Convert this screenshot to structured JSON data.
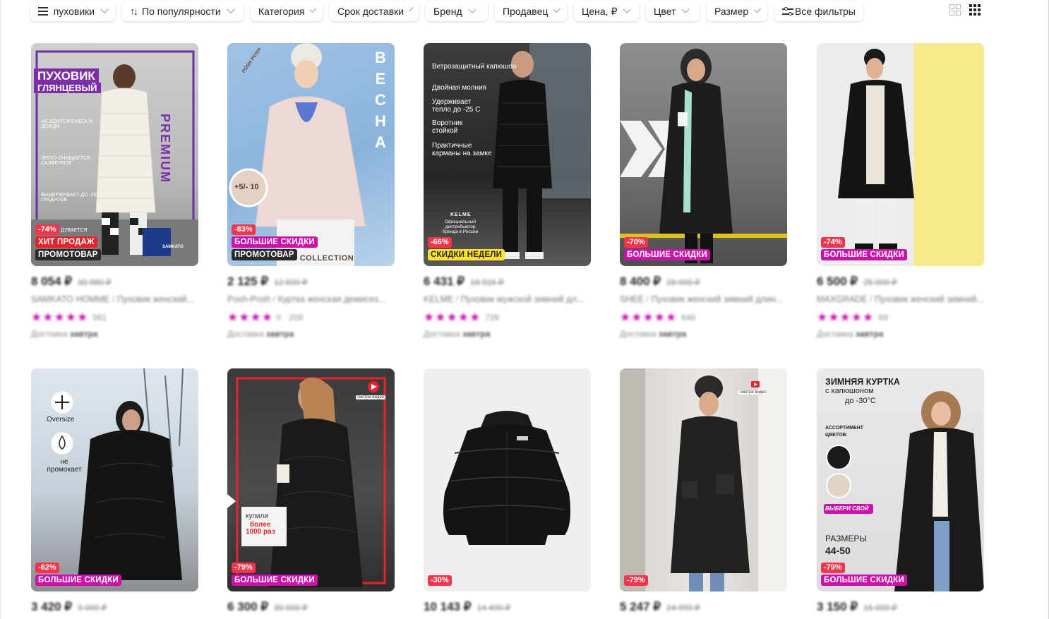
{
  "filters": [
    {
      "label": "пуховики",
      "icon": "menu-icon"
    },
    {
      "label": "По популярности",
      "icon": "sort-icon"
    },
    {
      "label": "Категория"
    },
    {
      "label": "Срок доставки"
    },
    {
      "label": "Бренд"
    },
    {
      "label": "Продавец"
    },
    {
      "label": "Цена, ₽"
    },
    {
      "label": "Цвет"
    },
    {
      "label": "Размер"
    },
    {
      "label": "Все фильтры",
      "icon": "sliders-icon"
    }
  ],
  "view": {
    "large_grid": "grid-2x2-icon",
    "small_grid": "grid-3x3-icon"
  },
  "colors": {
    "accent": "#cb11ab",
    "discount": "#f4364c",
    "hit": "#e8232b",
    "weekly": "#ffe12e"
  },
  "products": [
    {
      "price": "8 054 ₽",
      "old_price": "30 980 ₽",
      "brand": "SAMKATO HOMME",
      "title": "Пуховик женский...",
      "rating_count": "561",
      "delivery_label": "Доставка",
      "delivery_day": "завтра",
      "discount": "-74%",
      "tags": [
        "ХИТ ПРОДАЖ",
        "ПРОМОТОВАР"
      ],
      "overlay": [
        "ПУХОВИК",
        "ГЛЯНЦЕВЫЙ",
        "PREMIUM",
        "НЕ БОИТСЯ СНЕГА И ДОЖДЯ",
        "ЛЕГКО ОЧИЩАЕТСЯ САЛФЕТКОЙ",
        "ВЫДЕРЖИВАЕТ ДО -20 ГРАДУСОВ",
        "ДУВАЕТСЯ",
        "SAMKATO"
      ]
    },
    {
      "price": "2 125 ₽",
      "old_price": "12 500 ₽",
      "brand": "Posh-Posh",
      "title": "Куртка женская демисез...",
      "rating_count": "209",
      "delivery_label": "Доставка",
      "delivery_day": "завтра",
      "discount": "-83%",
      "tags": [
        "БОЛЬШИЕ СКИДКИ",
        "ПРОМОТОВАР"
      ],
      "overlay": [
        "ВЕСНА",
        "+5/- 10",
        "NEW COLLECTION",
        "POSH POSH"
      ]
    },
    {
      "price": "6 431 ₽",
      "old_price": "18 915 ₽",
      "brand": "KELME",
      "title": "Пуховик мужской зимний дл...",
      "rating_count": "728",
      "delivery_label": "Доставка",
      "delivery_day": "завтра",
      "discount": "-66%",
      "tags": [
        "СКИДКИ НЕДЕЛИ"
      ],
      "overlay": [
        "Ветрозащитный капюшон",
        "Двойная молния",
        "Удерживает тепло до -25 С",
        "Воротник стойкой",
        "Практичные карманы на замке",
        "KELME",
        "Официальный дистрибьютор бренда в России"
      ]
    },
    {
      "price": "8 400 ₽",
      "old_price": "28 000 ₽",
      "brand": "SHEE",
      "title": "Пуховик женский зимний длин...",
      "rating_count": "646",
      "delivery_label": "Доставка",
      "delivery_day": "завтра",
      "discount": "-70%",
      "tags": [
        "БОЛЬШИЕ СКИДКИ"
      ],
      "overlay": []
    },
    {
      "price": "6 500 ₽",
      "old_price": "25 000 ₽",
      "brand": "MAXGRADE",
      "title": "Пуховик женский зимний...",
      "rating_count": "69",
      "delivery_label": "Доставка",
      "delivery_day": "завтра",
      "discount": "-74%",
      "tags": [
        "БОЛЬШИЕ СКИДКИ"
      ],
      "overlay": []
    },
    {
      "price": "3 420 ₽",
      "old_price": "9 000 ₽",
      "brand": "",
      "title": "",
      "rating_count": "",
      "delivery_label": "",
      "delivery_day": "",
      "discount": "-62%",
      "tags": [
        "БОЛЬШИЕ СКИДКИ"
      ],
      "overlay": [
        "Oversize",
        "не промокает"
      ]
    },
    {
      "price": "6 300 ₽",
      "old_price": "30 000 ₽",
      "brand": "",
      "title": "",
      "rating_count": "",
      "delivery_label": "",
      "delivery_day": "",
      "discount": "-79%",
      "tags": [
        "БОЛЬШИЕ СКИДКИ"
      ],
      "overlay": [
        "смотри видео",
        "купили",
        "более",
        "1000 раз"
      ]
    },
    {
      "price": "10 143 ₽",
      "old_price": "14 490 ₽",
      "brand": "",
      "title": "",
      "rating_count": "",
      "delivery_label": "",
      "delivery_day": "",
      "discount": "-30%",
      "tags": [],
      "overlay": []
    },
    {
      "price": "5 247 ₽",
      "old_price": "24 990 ₽",
      "brand": "",
      "title": "",
      "rating_count": "",
      "delivery_label": "",
      "delivery_day": "",
      "discount": "-79%",
      "tags": [],
      "overlay": [
        "смотри видео"
      ]
    },
    {
      "price": "3 150 ₽",
      "old_price": "15 000 ₽",
      "brand": "",
      "title": "",
      "rating_count": "",
      "delivery_label": "",
      "delivery_day": "",
      "discount": "-79%",
      "tags": [
        "БОЛЬШИЕ СКИДКИ"
      ],
      "overlay": [
        "ЗИМНЯЯ КУРТКА",
        "с капюшоном",
        "до -30°С",
        "АССОРТИМЕНТ ЦВЕТОВ:",
        "ВЫБЕРИ СВОЙ",
        "РАЗМЕРЫ",
        "44-50"
      ]
    }
  ]
}
